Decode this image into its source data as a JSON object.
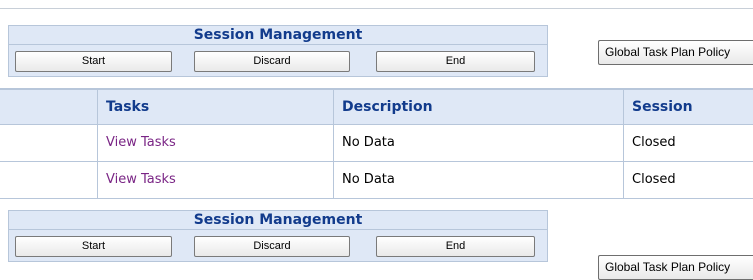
{
  "session": {
    "title": "Session Management",
    "start_label": "Start",
    "discard_label": "Discard",
    "end_label": "End"
  },
  "global_policy_label": "Global Task Plan Policy",
  "table": {
    "headers": [
      "Tasks",
      "Description",
      "Session"
    ],
    "rows": [
      {
        "task": "View Tasks",
        "description": "No Data",
        "session": "Closed"
      },
      {
        "task": "View Tasks",
        "description": "No Data",
        "session": "Closed"
      }
    ]
  }
}
